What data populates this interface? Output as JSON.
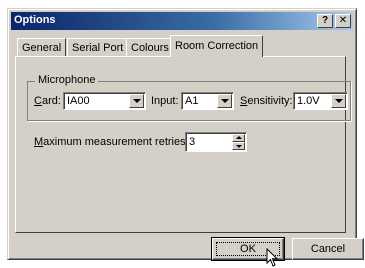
{
  "window": {
    "title": "Options"
  },
  "titlebar_buttons": {
    "help": "?",
    "close": "✕"
  },
  "tabs": [
    "General",
    "Serial Port",
    "Colours",
    "Room Correction"
  ],
  "active_tab": "Room Correction",
  "microphone": {
    "legend": "Microphone",
    "card_label": "Card:",
    "card_value": "IA00",
    "input_label": "Input:",
    "input_value": "A1",
    "sensitivity_label": "Sensitivity:",
    "sensitivity_value": "1.0V"
  },
  "retries": {
    "label": "Maximum measurement retries:",
    "value": "3"
  },
  "buttons": {
    "ok": "OK",
    "cancel": "Cancel"
  }
}
